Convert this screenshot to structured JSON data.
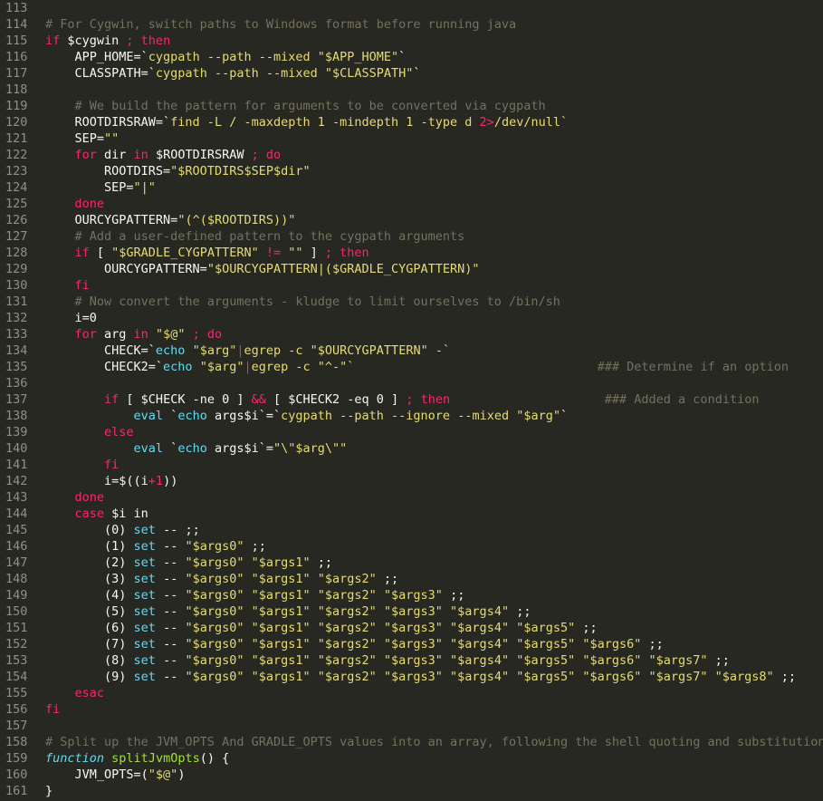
{
  "editor": {
    "lines": [
      {
        "n": "113",
        "tokens": []
      },
      {
        "n": "114",
        "tokens": [
          {
            "t": "# For Cygwin, switch paths to Windows format before running java",
            "c": "comment"
          }
        ]
      },
      {
        "n": "115",
        "tokens": [
          {
            "t": "if ",
            "c": "keyword"
          },
          {
            "t": "$cygwin",
            "c": "plain"
          },
          {
            "t": " ; then",
            "c": "keyword"
          }
        ]
      },
      {
        "n": "116",
        "tokens": [
          {
            "t": "    APP_HOME=`",
            "c": "plain"
          },
          {
            "t": "cygpath --path --mixed \"$APP_HOME\"",
            "c": "string"
          },
          {
            "t": "`",
            "c": "plain"
          }
        ]
      },
      {
        "n": "117",
        "tokens": [
          {
            "t": "    CLASSPATH=`",
            "c": "plain"
          },
          {
            "t": "cygpath --path --mixed \"$CLASSPATH\"",
            "c": "string"
          },
          {
            "t": "`",
            "c": "plain"
          }
        ]
      },
      {
        "n": "118",
        "tokens": []
      },
      {
        "n": "119",
        "tokens": [
          {
            "t": "    # We build the pattern for arguments to be converted via cygpath",
            "c": "comment"
          }
        ]
      },
      {
        "n": "120",
        "tokens": [
          {
            "t": "    ROOTDIRSRAW=`",
            "c": "plain"
          },
          {
            "t": "find -L / -maxdepth 1 -mindepth 1 -type d ",
            "c": "string"
          },
          {
            "t": "2>",
            "c": "keyword"
          },
          {
            "t": "/dev/null`",
            "c": "string"
          }
        ]
      },
      {
        "n": "121",
        "tokens": [
          {
            "t": "    SEP=",
            "c": "plain"
          },
          {
            "t": "\"\"",
            "c": "string"
          }
        ]
      },
      {
        "n": "122",
        "tokens": [
          {
            "t": "    ",
            "c": "plain"
          },
          {
            "t": "for",
            "c": "keyword"
          },
          {
            "t": " dir ",
            "c": "plain"
          },
          {
            "t": "in",
            "c": "keyword"
          },
          {
            "t": " $ROOTDIRSRAW ",
            "c": "plain"
          },
          {
            "t": "; do",
            "c": "keyword"
          }
        ]
      },
      {
        "n": "123",
        "tokens": [
          {
            "t": "        ROOTDIRS=",
            "c": "plain"
          },
          {
            "t": "\"$ROOTDIRS$SEP$dir\"",
            "c": "string"
          }
        ]
      },
      {
        "n": "124",
        "tokens": [
          {
            "t": "        SEP=",
            "c": "plain"
          },
          {
            "t": "\"|\"",
            "c": "string"
          }
        ]
      },
      {
        "n": "125",
        "tokens": [
          {
            "t": "    ",
            "c": "plain"
          },
          {
            "t": "done",
            "c": "keyword"
          }
        ]
      },
      {
        "n": "126",
        "tokens": [
          {
            "t": "    OURCYGPATTERN=",
            "c": "plain"
          },
          {
            "t": "\"(^($ROOTDIRS))\"",
            "c": "string"
          }
        ]
      },
      {
        "n": "127",
        "tokens": [
          {
            "t": "    # Add a user-defined pattern to the cygpath arguments",
            "c": "comment"
          }
        ]
      },
      {
        "n": "128",
        "tokens": [
          {
            "t": "    ",
            "c": "plain"
          },
          {
            "t": "if",
            "c": "keyword"
          },
          {
            "t": " [ ",
            "c": "plain"
          },
          {
            "t": "\"$GRADLE_CYGPATTERN\"",
            "c": "string"
          },
          {
            "t": " != ",
            "c": "keyword"
          },
          {
            "t": "\"\"",
            "c": "string"
          },
          {
            "t": " ] ",
            "c": "plain"
          },
          {
            "t": "; then",
            "c": "keyword"
          }
        ]
      },
      {
        "n": "129",
        "tokens": [
          {
            "t": "        OURCYGPATTERN=",
            "c": "plain"
          },
          {
            "t": "\"$OURCYGPATTERN|($GRADLE_CYGPATTERN)\"",
            "c": "string"
          }
        ]
      },
      {
        "n": "130",
        "tokens": [
          {
            "t": "    ",
            "c": "plain"
          },
          {
            "t": "fi",
            "c": "keyword"
          }
        ]
      },
      {
        "n": "131",
        "tokens": [
          {
            "t": "    # Now convert the arguments - kludge to limit ourselves to /bin/sh",
            "c": "comment"
          }
        ]
      },
      {
        "n": "132",
        "tokens": [
          {
            "t": "    i=0",
            "c": "plain"
          }
        ]
      },
      {
        "n": "133",
        "tokens": [
          {
            "t": "    ",
            "c": "plain"
          },
          {
            "t": "for",
            "c": "keyword"
          },
          {
            "t": " arg ",
            "c": "plain"
          },
          {
            "t": "in",
            "c": "keyword"
          },
          {
            "t": " ",
            "c": "plain"
          },
          {
            "t": "\"$@\"",
            "c": "string"
          },
          {
            "t": " ; do",
            "c": "keyword"
          }
        ]
      },
      {
        "n": "134",
        "tokens": [
          {
            "t": "        CHECK=`",
            "c": "plain"
          },
          {
            "t": "echo",
            "c": "builtin"
          },
          {
            "t": " ",
            "c": "plain"
          },
          {
            "t": "\"$arg\"",
            "c": "string"
          },
          {
            "t": "|",
            "c": "keyword"
          },
          {
            "t": "egrep -c ",
            "c": "string"
          },
          {
            "t": "\"$OURCYGPATTERN\"",
            "c": "string"
          },
          {
            "t": " -`",
            "c": "string"
          }
        ]
      },
      {
        "n": "135",
        "tokens": [
          {
            "t": "        CHECK2=`",
            "c": "plain"
          },
          {
            "t": "echo",
            "c": "builtin"
          },
          {
            "t": " ",
            "c": "plain"
          },
          {
            "t": "\"$arg\"",
            "c": "string"
          },
          {
            "t": "|",
            "c": "keyword"
          },
          {
            "t": "egrep -c ",
            "c": "string"
          },
          {
            "t": "\"^-\"",
            "c": "string"
          },
          {
            "t": "`",
            "c": "string"
          },
          {
            "t": "                                 ### Determine if an option",
            "c": "comment"
          }
        ]
      },
      {
        "n": "136",
        "tokens": []
      },
      {
        "n": "137",
        "tokens": [
          {
            "t": "        ",
            "c": "plain"
          },
          {
            "t": "if",
            "c": "keyword"
          },
          {
            "t": " [ $CHECK -ne 0 ] ",
            "c": "plain"
          },
          {
            "t": "&&",
            "c": "keyword"
          },
          {
            "t": " [ $CHECK2 -eq 0 ] ",
            "c": "plain"
          },
          {
            "t": "; then",
            "c": "keyword"
          },
          {
            "t": "                     ### Added a condition",
            "c": "comment"
          }
        ]
      },
      {
        "n": "138",
        "tokens": [
          {
            "t": "            ",
            "c": "plain"
          },
          {
            "t": "eval",
            "c": "builtin"
          },
          {
            "t": " `",
            "c": "plain"
          },
          {
            "t": "echo",
            "c": "builtin"
          },
          {
            "t": " args$i`=`",
            "c": "plain"
          },
          {
            "t": "cygpath --path --ignore --mixed \"$arg\"",
            "c": "string"
          },
          {
            "t": "`",
            "c": "plain"
          }
        ]
      },
      {
        "n": "139",
        "tokens": [
          {
            "t": "        ",
            "c": "plain"
          },
          {
            "t": "else",
            "c": "keyword"
          }
        ]
      },
      {
        "n": "140",
        "tokens": [
          {
            "t": "            ",
            "c": "plain"
          },
          {
            "t": "eval",
            "c": "builtin"
          },
          {
            "t": " `",
            "c": "plain"
          },
          {
            "t": "echo",
            "c": "builtin"
          },
          {
            "t": " args$i`=",
            "c": "plain"
          },
          {
            "t": "\"\\\"$arg\\\"\"",
            "c": "string"
          }
        ]
      },
      {
        "n": "141",
        "tokens": [
          {
            "t": "        ",
            "c": "plain"
          },
          {
            "t": "fi",
            "c": "keyword"
          }
        ]
      },
      {
        "n": "142",
        "tokens": [
          {
            "t": "        i=$((i",
            "c": "plain"
          },
          {
            "t": "+1",
            "c": "keyword"
          },
          {
            "t": "))",
            "c": "plain"
          }
        ]
      },
      {
        "n": "143",
        "tokens": [
          {
            "t": "    ",
            "c": "plain"
          },
          {
            "t": "done",
            "c": "keyword"
          }
        ]
      },
      {
        "n": "144",
        "tokens": [
          {
            "t": "    ",
            "c": "plain"
          },
          {
            "t": "case",
            "c": "keyword"
          },
          {
            "t": " $i in",
            "c": "plain"
          }
        ]
      },
      {
        "n": "145",
        "tokens": [
          {
            "t": "        (0) ",
            "c": "plain"
          },
          {
            "t": "set",
            "c": "builtin"
          },
          {
            "t": " -- ;;",
            "c": "plain"
          }
        ]
      },
      {
        "n": "146",
        "tokens": [
          {
            "t": "        (1) ",
            "c": "plain"
          },
          {
            "t": "set",
            "c": "builtin"
          },
          {
            "t": " -- ",
            "c": "plain"
          },
          {
            "t": "\"$args0\"",
            "c": "string"
          },
          {
            "t": " ;;",
            "c": "plain"
          }
        ]
      },
      {
        "n": "147",
        "tokens": [
          {
            "t": "        (2) ",
            "c": "plain"
          },
          {
            "t": "set",
            "c": "builtin"
          },
          {
            "t": " -- ",
            "c": "plain"
          },
          {
            "t": "\"$args0\" \"$args1\"",
            "c": "string"
          },
          {
            "t": " ;;",
            "c": "plain"
          }
        ]
      },
      {
        "n": "148",
        "tokens": [
          {
            "t": "        (3) ",
            "c": "plain"
          },
          {
            "t": "set",
            "c": "builtin"
          },
          {
            "t": " -- ",
            "c": "plain"
          },
          {
            "t": "\"$args0\" \"$args1\" \"$args2\"",
            "c": "string"
          },
          {
            "t": " ;;",
            "c": "plain"
          }
        ]
      },
      {
        "n": "149",
        "tokens": [
          {
            "t": "        (4) ",
            "c": "plain"
          },
          {
            "t": "set",
            "c": "builtin"
          },
          {
            "t": " -- ",
            "c": "plain"
          },
          {
            "t": "\"$args0\" \"$args1\" \"$args2\" \"$args3\"",
            "c": "string"
          },
          {
            "t": " ;;",
            "c": "plain"
          }
        ]
      },
      {
        "n": "150",
        "tokens": [
          {
            "t": "        (5) ",
            "c": "plain"
          },
          {
            "t": "set",
            "c": "builtin"
          },
          {
            "t": " -- ",
            "c": "plain"
          },
          {
            "t": "\"$args0\" \"$args1\" \"$args2\" \"$args3\" \"$args4\"",
            "c": "string"
          },
          {
            "t": " ;;",
            "c": "plain"
          }
        ]
      },
      {
        "n": "151",
        "tokens": [
          {
            "t": "        (6) ",
            "c": "plain"
          },
          {
            "t": "set",
            "c": "builtin"
          },
          {
            "t": " -- ",
            "c": "plain"
          },
          {
            "t": "\"$args0\" \"$args1\" \"$args2\" \"$args3\" \"$args4\" \"$args5\"",
            "c": "string"
          },
          {
            "t": " ;;",
            "c": "plain"
          }
        ]
      },
      {
        "n": "152",
        "tokens": [
          {
            "t": "        (7) ",
            "c": "plain"
          },
          {
            "t": "set",
            "c": "builtin"
          },
          {
            "t": " -- ",
            "c": "plain"
          },
          {
            "t": "\"$args0\" \"$args1\" \"$args2\" \"$args3\" \"$args4\" \"$args5\" \"$args6\"",
            "c": "string"
          },
          {
            "t": " ;;",
            "c": "plain"
          }
        ]
      },
      {
        "n": "153",
        "tokens": [
          {
            "t": "        (8) ",
            "c": "plain"
          },
          {
            "t": "set",
            "c": "builtin"
          },
          {
            "t": " -- ",
            "c": "plain"
          },
          {
            "t": "\"$args0\" \"$args1\" \"$args2\" \"$args3\" \"$args4\" \"$args5\" \"$args6\" \"$args7\"",
            "c": "string"
          },
          {
            "t": " ;;",
            "c": "plain"
          }
        ]
      },
      {
        "n": "154",
        "tokens": [
          {
            "t": "        (9) ",
            "c": "plain"
          },
          {
            "t": "set",
            "c": "builtin"
          },
          {
            "t": " -- ",
            "c": "plain"
          },
          {
            "t": "\"$args0\" \"$args1\" \"$args2\" \"$args3\" \"$args4\" \"$args5\" \"$args6\" \"$args7\" \"$args8\"",
            "c": "string"
          },
          {
            "t": " ;;",
            "c": "plain"
          }
        ]
      },
      {
        "n": "155",
        "tokens": [
          {
            "t": "    ",
            "c": "plain"
          },
          {
            "t": "esac",
            "c": "keyword"
          }
        ]
      },
      {
        "n": "156",
        "tokens": [
          {
            "t": "fi",
            "c": "keyword"
          }
        ]
      },
      {
        "n": "157",
        "tokens": []
      },
      {
        "n": "158",
        "tokens": [
          {
            "t": "# Split up the JVM_OPTS And GRADLE_OPTS values into an array, following the shell quoting and substitution r",
            "c": "comment"
          }
        ]
      },
      {
        "n": "159",
        "tokens": [
          {
            "t": "function",
            "c": "storage"
          },
          {
            "t": " ",
            "c": "plain"
          },
          {
            "t": "splitJvmOpts",
            "c": "func"
          },
          {
            "t": "() {",
            "c": "plain"
          }
        ]
      },
      {
        "n": "160",
        "tokens": [
          {
            "t": "    JVM_OPTS=(",
            "c": "plain"
          },
          {
            "t": "\"$@\"",
            "c": "string"
          },
          {
            "t": ")",
            "c": "plain"
          }
        ]
      },
      {
        "n": "161",
        "tokens": [
          {
            "t": "}",
            "c": "plain"
          }
        ]
      }
    ]
  },
  "colors": {
    "background": "#272822",
    "comment": "#75715e",
    "keyword": "#f92672",
    "string": "#e6db74",
    "builtin": "#66d9ef",
    "plain": "#f8f8f2",
    "func": "#a6e22e",
    "line_number": "#90908a"
  }
}
